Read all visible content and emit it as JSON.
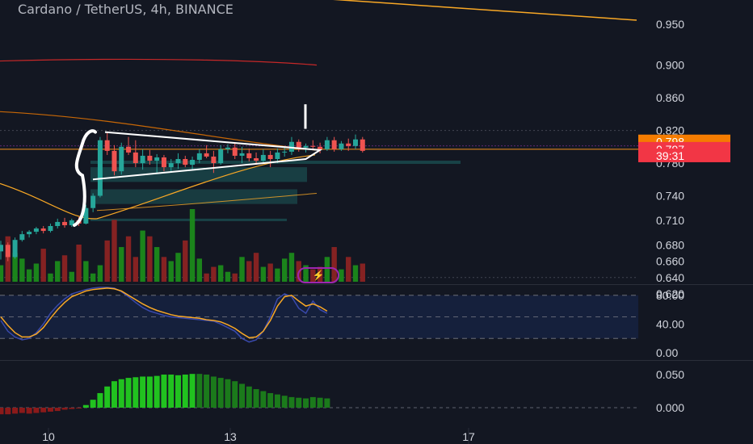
{
  "header": {
    "title": "Cardano / TetherUS, 4h, BINANCE"
  },
  "colors": {
    "background": "#131722",
    "up": "#26a69a",
    "down": "#ef5350",
    "price_line": "#f7931a",
    "label_orange": "#f57c00",
    "label_red": "#f23645",
    "axis_text": "#d1d4dc",
    "k_line": "#3949ab",
    "d_line": "#f9a825"
  },
  "icons": {
    "replay": "lightning-icon"
  },
  "chart_data": [
    {
      "type": "candlestick",
      "title": "Cardano / TetherUS, 4h, BINANCE",
      "ylim": [
        0.612,
        0.985
      ],
      "y_ticks": [
        "0.950",
        "0.900",
        "0.860",
        "0.820",
        "0.780",
        "0.740",
        "0.710",
        "0.680",
        "0.660",
        "0.640",
        "0.620"
      ],
      "x_ticks": [
        "10",
        "13",
        "17"
      ],
      "candles": [
        [
          0.672,
          0.685,
          0.662,
          0.68
        ],
        [
          0.68,
          0.683,
          0.66,
          0.665
        ],
        [
          0.665,
          0.689,
          0.663,
          0.686
        ],
        [
          0.686,
          0.697,
          0.684,
          0.693
        ],
        [
          0.693,
          0.698,
          0.689,
          0.696
        ],
        [
          0.696,
          0.702,
          0.693,
          0.7
        ],
        [
          0.7,
          0.703,
          0.694,
          0.697
        ],
        [
          0.697,
          0.706,
          0.695,
          0.703
        ],
        [
          0.703,
          0.712,
          0.7,
          0.708
        ],
        [
          0.708,
          0.713,
          0.701,
          0.704
        ],
        [
          0.704,
          0.712,
          0.702,
          0.71
        ],
        [
          0.71,
          0.714,
          0.703,
          0.706
        ],
        [
          0.706,
          0.729,
          0.705,
          0.725
        ],
        [
          0.725,
          0.743,
          0.72,
          0.74
        ],
        [
          0.74,
          0.812,
          0.738,
          0.808
        ],
        [
          0.808,
          0.818,
          0.79,
          0.795
        ],
        [
          0.795,
          0.802,
          0.765,
          0.77
        ],
        [
          0.77,
          0.805,
          0.766,
          0.8
        ],
        [
          0.8,
          0.812,
          0.79,
          0.793
        ],
        [
          0.793,
          0.808,
          0.775,
          0.78
        ],
        [
          0.78,
          0.797,
          0.772,
          0.789
        ],
        [
          0.789,
          0.796,
          0.778,
          0.783
        ],
        [
          0.783,
          0.791,
          0.768,
          0.787
        ],
        [
          0.787,
          0.79,
          0.77,
          0.775
        ],
        [
          0.775,
          0.785,
          0.77,
          0.78
        ],
        [
          0.78,
          0.792,
          0.773,
          0.785
        ],
        [
          0.785,
          0.789,
          0.775,
          0.778
        ],
        [
          0.778,
          0.788,
          0.772,
          0.784
        ],
        [
          0.784,
          0.797,
          0.78,
          0.792
        ],
        [
          0.792,
          0.802,
          0.786,
          0.788
        ],
        [
          0.788,
          0.795,
          0.768,
          0.78
        ],
        [
          0.78,
          0.802,
          0.778,
          0.797
        ],
        [
          0.797,
          0.803,
          0.792,
          0.799
        ],
        [
          0.799,
          0.804,
          0.785,
          0.789
        ],
        [
          0.789,
          0.8,
          0.78,
          0.792
        ],
        [
          0.792,
          0.798,
          0.782,
          0.786
        ],
        [
          0.786,
          0.793,
          0.778,
          0.783
        ],
        [
          0.783,
          0.797,
          0.78,
          0.79
        ],
        [
          0.79,
          0.795,
          0.775,
          0.785
        ],
        [
          0.785,
          0.798,
          0.78,
          0.793
        ],
        [
          0.793,
          0.8,
          0.788,
          0.794
        ],
        [
          0.794,
          0.812,
          0.79,
          0.806
        ],
        [
          0.806,
          0.809,
          0.794,
          0.799
        ],
        [
          0.799,
          0.804,
          0.793,
          0.801
        ],
        [
          0.801,
          0.808,
          0.796,
          0.8
        ],
        [
          0.8,
          0.805,
          0.792,
          0.797
        ],
        [
          0.797,
          0.812,
          0.795,
          0.808
        ],
        [
          0.808,
          0.812,
          0.794,
          0.797
        ],
        [
          0.797,
          0.807,
          0.795,
          0.804
        ],
        [
          0.804,
          0.81,
          0.795,
          0.801
        ],
        [
          0.801,
          0.815,
          0.797,
          0.809
        ],
        [
          0.809,
          0.812,
          0.793,
          0.795
        ]
      ],
      "volume": [
        0.2,
        0.55,
        0.35,
        0.28,
        0.15,
        0.22,
        0.4,
        0.1,
        0.25,
        0.32,
        0.12,
        0.45,
        0.25,
        0.1,
        0.2,
        0.5,
        0.75,
        0.42,
        0.55,
        0.3,
        0.62,
        0.55,
        0.42,
        0.3,
        0.25,
        0.35,
        0.5,
        0.88,
        0.28,
        0.1,
        0.18,
        0.2,
        0.12,
        0.1,
        0.3,
        0.25,
        0.35,
        0.18,
        0.22,
        0.16,
        0.28,
        0.35,
        0.25,
        0.2,
        0.15,
        0.18,
        0.3,
        0.42,
        0.15,
        0.3,
        0.2,
        0.22
      ],
      "last_price": "0.797",
      "high_marker": "0.798",
      "countdown": "39:31",
      "annotations": [
        "triangle",
        "rectangle"
      ]
    },
    {
      "type": "line",
      "name": "stochastic",
      "ylim": [
        0.0,
        100.0
      ],
      "y_ticks": [
        "80.00",
        "40.00",
        "0.00"
      ],
      "band": [
        20,
        80
      ],
      "series": [
        {
          "color": "#3949ab",
          "values": [
            45,
            30,
            22,
            18,
            20,
            28,
            40,
            55,
            66,
            75,
            82,
            85,
            88,
            90,
            91,
            91,
            90,
            85,
            78,
            70,
            63,
            58,
            55,
            52,
            50,
            49,
            48,
            47,
            46,
            45,
            44,
            40,
            35,
            30,
            20,
            15,
            18,
            30,
            50,
            75,
            82,
            78,
            62,
            55,
            72,
            60,
            55
          ]
        },
        {
          "color": "#f9a825",
          "values": [
            50,
            38,
            28,
            22,
            22,
            26,
            35,
            48,
            60,
            70,
            78,
            82,
            86,
            88,
            89,
            90,
            89,
            86,
            80,
            74,
            68,
            63,
            59,
            56,
            53,
            51,
            50,
            49,
            48,
            46,
            45,
            43,
            39,
            34,
            27,
            21,
            22,
            30,
            45,
            65,
            78,
            80,
            72,
            65,
            68,
            64,
            58
          ]
        }
      ]
    },
    {
      "type": "bar",
      "name": "histogram",
      "ylim": [
        -0.012,
        0.075
      ],
      "y_ticks": [
        "0.050",
        "0.000"
      ],
      "values": [
        -0.01,
        -0.01,
        -0.009,
        -0.008,
        -0.009,
        -0.008,
        -0.007,
        -0.006,
        -0.005,
        -0.003,
        -0.002,
        -0.001,
        0.004,
        0.012,
        0.022,
        0.032,
        0.04,
        0.043,
        0.045,
        0.046,
        0.047,
        0.047,
        0.048,
        0.05,
        0.05,
        0.049,
        0.05,
        0.051,
        0.051,
        0.05,
        0.047,
        0.045,
        0.043,
        0.04,
        0.036,
        0.032,
        0.028,
        0.025,
        0.022,
        0.02,
        0.018,
        0.016,
        0.015,
        0.014,
        0.016,
        0.015,
        0.014
      ]
    }
  ]
}
